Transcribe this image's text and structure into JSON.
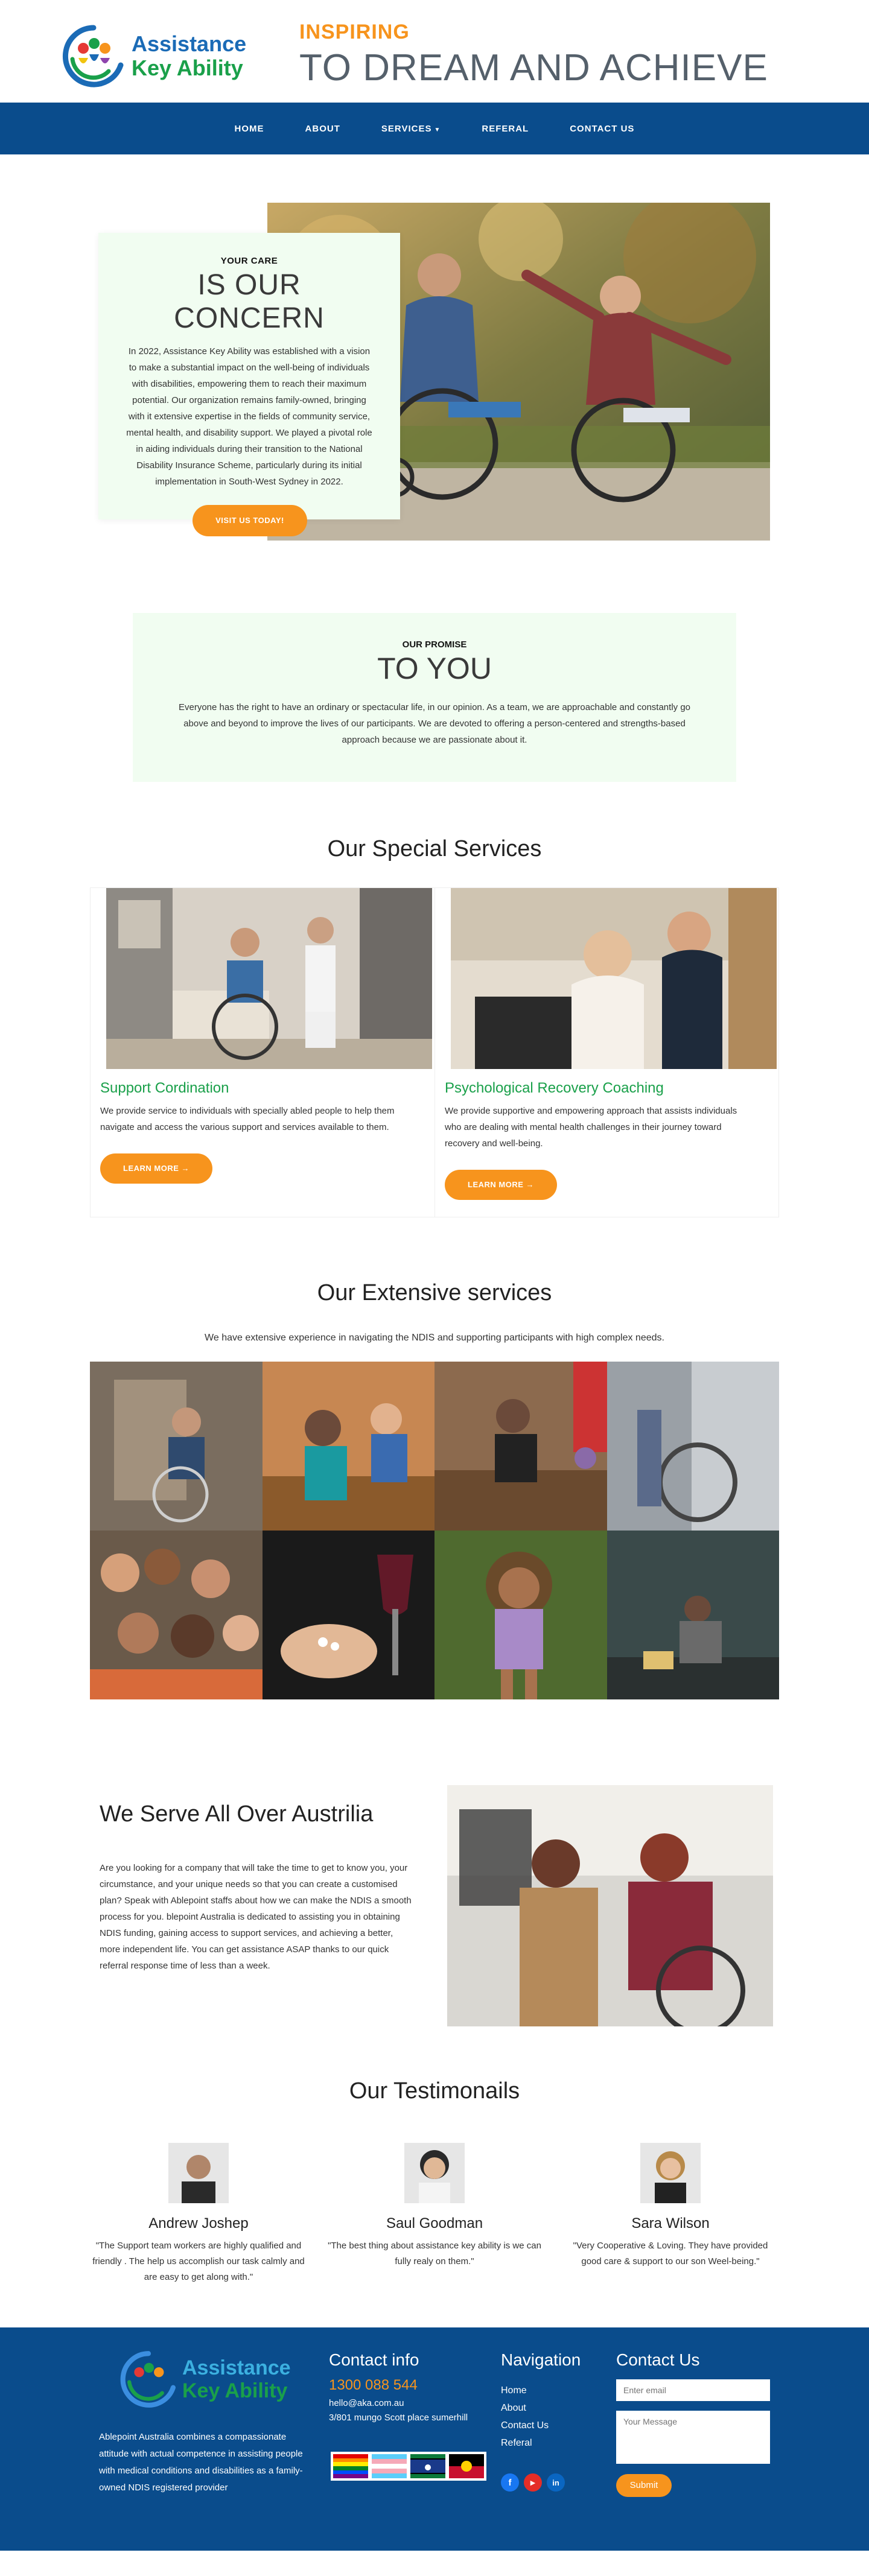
{
  "brand": {
    "logo_line1": "Assistance",
    "logo_line2": "Key Ability",
    "tagline_small": "INSPIRING",
    "tagline_big": "TO DREAM AND ACHIEVE",
    "colors": {
      "blue": "#0a4c8c",
      "orange": "#f7941d",
      "green": "#1aa04a",
      "pale_green": "#f1fdf1"
    }
  },
  "nav": {
    "items": [
      {
        "label": "HOME"
      },
      {
        "label": "ABOUT"
      },
      {
        "label": "SERVICES"
      },
      {
        "label": "REFERAL"
      },
      {
        "label": "CONTACT US"
      }
    ]
  },
  "concern": {
    "eyebrow": "YOUR CARE",
    "title": "IS OUR CONCERN",
    "body": "In 2022, Assistance Key Ability was established with a vision to make a substantial impact on the well-being of individuals with disabilities, empowering them to reach their maximum potential. Our organization remains family-owned, bringing with it extensive expertise in the fields of community service, mental health, and disability support. We played a pivotal role in aiding individuals during their transition to the National Disability Insurance Scheme, particularly during its initial implementation in South-West Sydney in 2022.",
    "button": "VISIT US TODAY!"
  },
  "promise": {
    "eyebrow": "OUR PROMISE",
    "title": "TO YOU",
    "body": "Everyone has the right to have an ordinary or spectacular life, in our opinion. As a team, we are approachable and constantly go above and beyond to improve the lives of our participants. We are devoted to offering a person-centered and strengths-based approach because we are passionate about it."
  },
  "special_services": {
    "title": "Our Special Services",
    "items": [
      {
        "title": "Support Cordination",
        "body": "We provide service to individuals with specially abled people to help them navigate and access the various support and services available to them.",
        "button": "LEARN MORE →"
      },
      {
        "title": "Psychological Recovery Coaching",
        "body": "We provide supportive and empowering approach that assists individuals who are dealing with mental health challenges in their journey toward recovery and well-being.",
        "button": "LEARN MORE →"
      }
    ]
  },
  "extensive": {
    "title": "Our Extensive services",
    "subtitle": "We have extensive experience in navigating the NDIS and supporting participants with high complex needs."
  },
  "serve": {
    "title": "We Serve All Over Austrilia",
    "body": "Are you looking for a company that will take the time to get to know you, your circumstance, and your unique needs so that you can create a customised plan? Speak with Ablepoint staffs about how we can make the NDIS a smooth process for you. blepoint Australia is dedicated to assisting you in obtaining NDIS funding, gaining access to support services, and achieving a better, more independent life. You can get assistance ASAP thanks to our quick referral response time of less than a week."
  },
  "testimonials": {
    "title": "Our Testimonails",
    "items": [
      {
        "name": "Andrew Joshep",
        "quote": "\"The Support team workers are highly qualified and friendly . The help us accomplish our task calmly and are easy to get along with.\""
      },
      {
        "name": "Saul Goodman",
        "quote": "\"The best thing about assistance key ability is we can fully realy on them.\""
      },
      {
        "name": "Sara Wilson",
        "quote": "\"Very Cooperative & Loving. They have provided good care & support to our son Weel-being.\""
      }
    ]
  },
  "footer": {
    "about": "Ablepoint Australia combines a compassionate attitude with actual competence in assisting people with medical conditions and disabilities as a family-owned NDIS registered provider",
    "contact_title": "Contact info",
    "phone": "1300 088 544",
    "email": "hello@aka.com.au",
    "address": "3/801 mungo Scott place sumerhill",
    "nav_title": "Navigation",
    "nav_items": [
      {
        "label": "Home"
      },
      {
        "label": "About"
      },
      {
        "label": "Contact Us"
      },
      {
        "label": "Referal"
      }
    ],
    "form_title": "Contact Us",
    "email_placeholder": "Enter email",
    "message_placeholder": "Your Message",
    "submit": "Submit",
    "social": [
      {
        "icon": "facebook-icon",
        "glyph": "f",
        "color": "#1877f2"
      },
      {
        "icon": "youtube-icon",
        "glyph": "▶",
        "color": "#e52d27"
      },
      {
        "icon": "linkedin-icon",
        "glyph": "in",
        "color": "#0a66c2"
      }
    ]
  }
}
